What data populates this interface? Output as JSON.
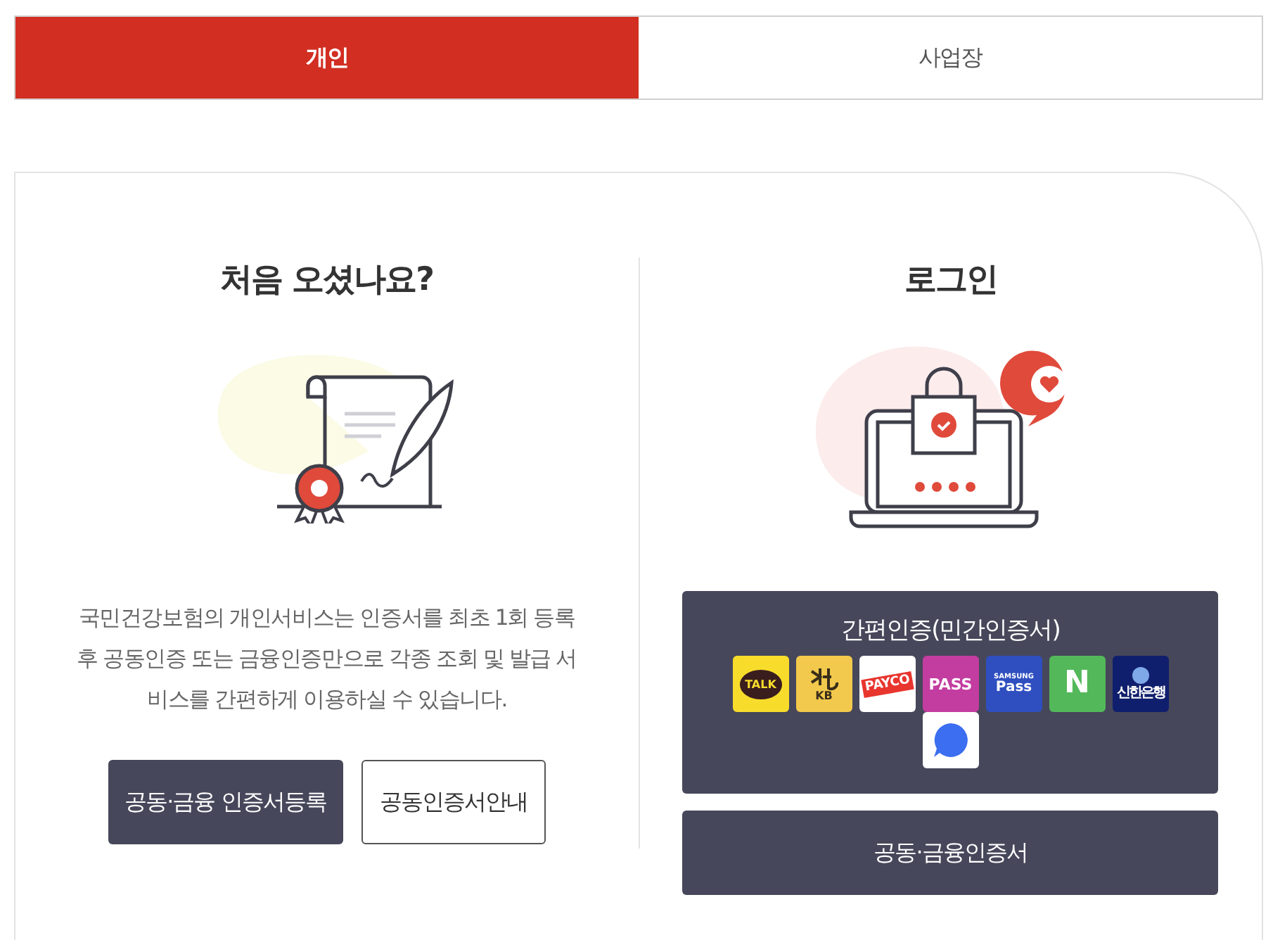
{
  "tabs": [
    {
      "label": "개인",
      "selected": true
    },
    {
      "label": "사업장",
      "selected": false
    }
  ],
  "new_user": {
    "title": "처음 오셨나요?",
    "description": "국민건강보험의 개인서비스는 인증서를 최초 1회 등록 후 공동인증 또는 금융인증만으로 각종 조회 및 발급 서비스를 간편하게 이용하실 수 있습니다.",
    "buttons": [
      {
        "label": "공동·금융 인증서등록",
        "kind": "primary"
      },
      {
        "label": "공동인증서안내",
        "kind": "outline"
      }
    ]
  },
  "login": {
    "title": "로그인",
    "simple_auth": {
      "title": "간편인증(민간인증서)",
      "providers": [
        {
          "kind": "kakao",
          "label": "TALK"
        },
        {
          "kind": "kb",
          "label": "KB"
        },
        {
          "kind": "payco",
          "label": "PAYCO"
        },
        {
          "kind": "pass",
          "label": "PASS"
        },
        {
          "kind": "samsung",
          "label": "SAMSUNG",
          "sublabel": "Pass"
        },
        {
          "kind": "naver",
          "label": "N"
        },
        {
          "kind": "shinhan",
          "label": "신한은행"
        },
        {
          "kind": "toss"
        }
      ]
    },
    "certificate_button": "공동·금융인증서"
  }
}
